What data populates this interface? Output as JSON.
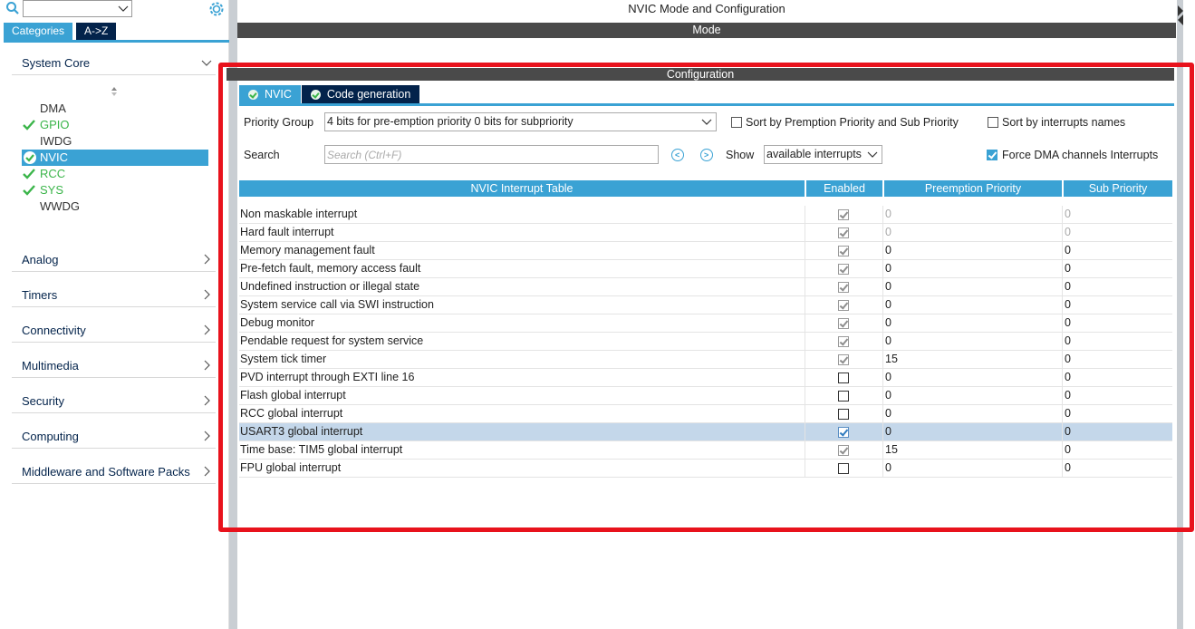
{
  "sidebar": {
    "search_value": "",
    "tabs": {
      "categories": "Categories",
      "az": "A->Z"
    },
    "categories": {
      "system_core": "System Core",
      "analog": "Analog",
      "timers": "Timers",
      "connectivity": "Connectivity",
      "multimedia": "Multimedia",
      "security": "Security",
      "computing": "Computing",
      "middleware": "Middleware and Software Packs"
    },
    "items": [
      {
        "label": "DMA",
        "checked": false
      },
      {
        "label": "GPIO",
        "checked": true
      },
      {
        "label": "IWDG",
        "checked": false
      },
      {
        "label": "NVIC",
        "checked": true,
        "selected": true
      },
      {
        "label": "RCC",
        "checked": true
      },
      {
        "label": "SYS",
        "checked": true
      },
      {
        "label": "WWDG",
        "checked": false
      }
    ]
  },
  "main": {
    "title": "NVIC Mode and Configuration",
    "mode_label": "Mode",
    "config_label": "Configuration",
    "tabs": {
      "nvic": "NVIC",
      "code_generation": "Code generation"
    },
    "priority_group_label": "Priority Group",
    "priority_group_value": "4 bits for pre-emption priority 0 bits for subpriority",
    "sort_preemption_label": "Sort by Premption Priority and Sub Priority",
    "sort_names_label": "Sort by interrupts names",
    "search_label": "Search",
    "search_placeholder": "Search (Ctrl+F)",
    "show_label": "Show",
    "show_value": "available interrupts",
    "force_dma_label": "Force DMA channels Interrupts",
    "force_dma_checked": true
  },
  "table": {
    "headers": {
      "name": "NVIC Interrupt Table",
      "enabled": "Enabled",
      "preemption": "Preemption Priority",
      "sub": "Sub Priority"
    },
    "rows": [
      {
        "name": "Non maskable interrupt",
        "enabled": true,
        "locked": true,
        "pre": "0",
        "sub": "0"
      },
      {
        "name": "Hard fault interrupt",
        "enabled": true,
        "locked": true,
        "pre": "0",
        "sub": "0"
      },
      {
        "name": "Memory management fault",
        "enabled": true,
        "locked": true,
        "pre": "0",
        "sub": "0"
      },
      {
        "name": "Pre-fetch fault, memory access fault",
        "enabled": true,
        "locked": true,
        "pre": "0",
        "sub": "0"
      },
      {
        "name": "Undefined instruction or illegal state",
        "enabled": true,
        "locked": true,
        "pre": "0",
        "sub": "0"
      },
      {
        "name": "System service call via SWI instruction",
        "enabled": true,
        "locked": true,
        "pre": "0",
        "sub": "0"
      },
      {
        "name": "Debug monitor",
        "enabled": true,
        "locked": true,
        "pre": "0",
        "sub": "0"
      },
      {
        "name": "Pendable request for system service",
        "enabled": true,
        "locked": true,
        "pre": "0",
        "sub": "0"
      },
      {
        "name": "System tick timer",
        "enabled": true,
        "locked": true,
        "pre": "15",
        "sub": "0"
      },
      {
        "name": "PVD interrupt through EXTI line 16",
        "enabled": false,
        "locked": false,
        "pre": "0",
        "sub": "0"
      },
      {
        "name": "Flash global interrupt",
        "enabled": false,
        "locked": false,
        "pre": "0",
        "sub": "0"
      },
      {
        "name": "RCC global interrupt",
        "enabled": false,
        "locked": false,
        "pre": "0",
        "sub": "0"
      },
      {
        "name": "USART3 global interrupt",
        "enabled": true,
        "locked": false,
        "pre": "0",
        "sub": "0",
        "selected": true
      },
      {
        "name": "Time base: TIM5 global interrupt",
        "enabled": true,
        "locked": true,
        "pre": "15",
        "sub": "0"
      },
      {
        "name": "FPU global interrupt",
        "enabled": false,
        "locked": false,
        "pre": "0",
        "sub": "0"
      }
    ]
  },
  "colors": {
    "accent": "#3aa2d4",
    "dark_navy": "#03234b",
    "bar_gray": "#4a4a4a",
    "check_green": "#3bb54a",
    "highlight_red": "#e8121c",
    "row_selected": "#c4d7ea"
  }
}
